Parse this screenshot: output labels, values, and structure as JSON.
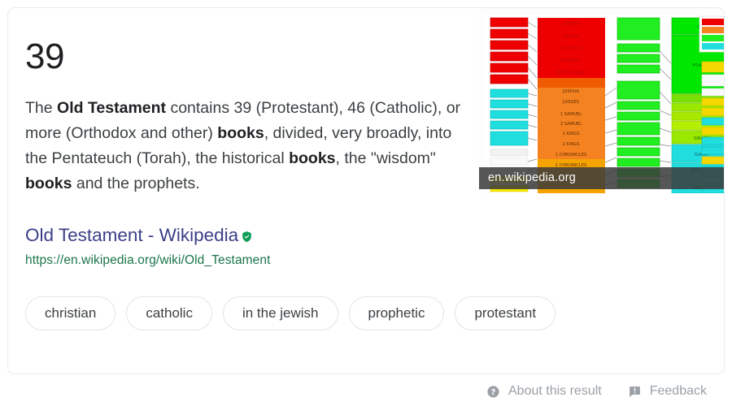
{
  "answer": {
    "number": "39",
    "description_parts": [
      {
        "text": "The ",
        "bold": false
      },
      {
        "text": "Old Testament",
        "bold": true
      },
      {
        "text": " contains 39 (Protestant), 46 (Catholic), or more (Orthodox and other) ",
        "bold": false
      },
      {
        "text": "books",
        "bold": true
      },
      {
        "text": ", divided, very broadly, into the Pentateuch (Torah), the historical ",
        "bold": false
      },
      {
        "text": "books",
        "bold": true
      },
      {
        "text": ", the \"wisdom\" ",
        "bold": false
      },
      {
        "text": "books",
        "bold": true
      },
      {
        "text": " and the prophets.",
        "bold": false
      }
    ]
  },
  "source": {
    "title": "Old Testament - Wikipedia",
    "url": "https://en.wikipedia.org/wiki/Old_Testament",
    "verified_icon": "verified-shield-icon",
    "badge_color": "#0f9d58"
  },
  "chips": [
    {
      "label": "christian"
    },
    {
      "label": "catholic"
    },
    {
      "label": "in the jewish"
    },
    {
      "label": "prophetic"
    },
    {
      "label": "protestant"
    }
  ],
  "thumbnail": {
    "source_label": "en.wikipedia.org",
    "alt": "color-coded diagram of the books of the Old Testament",
    "colors": {
      "red": "#ee0000",
      "orange": "#f58220",
      "yellow": "#f5d800",
      "green": "#20dd20",
      "green_bright": "#00e800",
      "green_yellow": "#a8e000",
      "cyan": "#20dede",
      "cyan_light": "#55e8f0",
      "white": "#fafafa"
    }
  },
  "footer": {
    "about": {
      "label": "About this result",
      "icon": "help-circle-icon"
    },
    "feedback": {
      "label": "Feedback",
      "icon": "feedback-bubble-icon"
    },
    "text_color": "#9aa0a6"
  },
  "card": {
    "background": "#ffffff",
    "border_color": "#ebebeb"
  }
}
